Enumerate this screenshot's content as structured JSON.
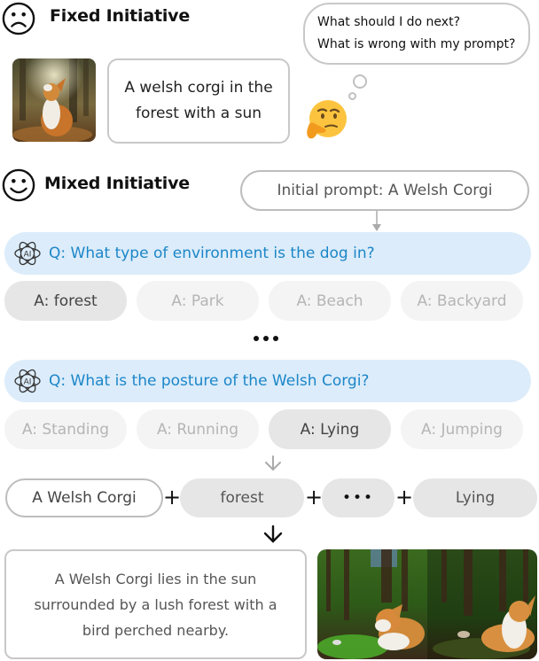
{
  "fixed_initiative": {
    "title": "Fixed Initiative",
    "face_icon": "sad-face-icon",
    "image_description": "corgi sitting in sunlit forest",
    "prompt_text": "A welsh corgi in the forest with a sun",
    "thought_bubble": {
      "lines": [
        "What should I do next?",
        "What is wrong with my prompt?"
      ]
    },
    "thinking_icon": "thinking-face-emoji"
  },
  "mixed_initiative": {
    "title": "Mixed Initiative",
    "face_icon": "smiley-face-icon",
    "initial_prompt": "Initial prompt: A Welsh Corgi",
    "questions": [
      {
        "icon": "ai-atom-icon",
        "text": "Q: What type of environment is the dog in?",
        "answers": [
          {
            "label": "A: forest",
            "selected": true
          },
          {
            "label": "A: Park",
            "selected": false
          },
          {
            "label": "A: Beach",
            "selected": false
          },
          {
            "label": "A: Backyard",
            "selected": false
          }
        ]
      },
      {
        "icon": "ai-atom-icon",
        "text": "Q: What is the posture of the Welsh Corgi?",
        "answers": [
          {
            "label": "A: Standing",
            "selected": false
          },
          {
            "label": "A: Running",
            "selected": false
          },
          {
            "label": "A: Lying",
            "selected": true
          },
          {
            "label": "A: Jumping",
            "selected": false
          }
        ]
      }
    ],
    "composition": {
      "parts": [
        "A Welsh Corgi",
        "forest",
        "•••",
        "Lying"
      ],
      "operator": "+"
    },
    "result_text": "A Welsh Corgi lies in the sun surrounded by a lush forest with a bird perched nearby.",
    "result_image_description": "two generated images of corgi lying in lush forest with bird"
  },
  "colors": {
    "question_bg": "#dcecfa",
    "question_text": "#1c86c8",
    "answer_selected_bg": "#e6e6e6",
    "answer_unselected_bg": "#f4f4f4",
    "answer_unselected_text": "#b5b5b5",
    "border": "#c8c8c8"
  }
}
